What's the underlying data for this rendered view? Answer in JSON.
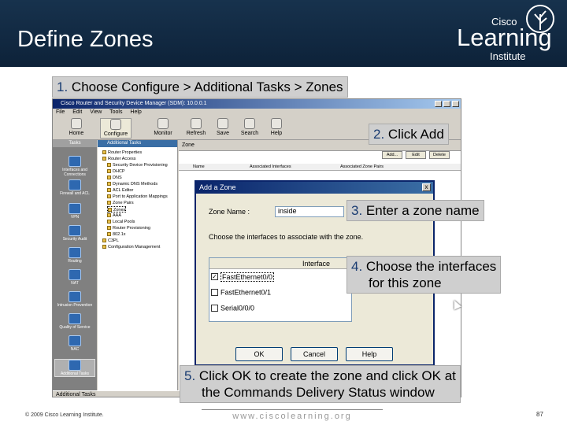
{
  "slide": {
    "title": "Define Zones",
    "logo": {
      "top": "Cisco",
      "main": "Learning",
      "bottom": "Institute"
    },
    "footer_copyright": "© 2009 Cisco Learning Institute.",
    "footer_url": "www.ciscolearning.org",
    "page_number": "87"
  },
  "callouts": [
    {
      "num": "1.",
      "text": " Choose Configure > Additional Tasks > Zones"
    },
    {
      "num": "2.",
      "text": " Click Add"
    },
    {
      "num": "3.",
      "text": " Enter a zone name"
    },
    {
      "num": "4.",
      "line1": " Choose the interfaces",
      "line2": "for this zone"
    },
    {
      "num": "5.",
      "line1": " Click OK to create the zone and click OK at",
      "line2": "the Commands Delivery Status window"
    }
  ],
  "app": {
    "window_title": "Cisco Router and Security Device Manager (SDM): 10.0.0.1",
    "menu": [
      "File",
      "Edit",
      "View",
      "Tools",
      "Help"
    ],
    "toolbar": [
      "Home",
      "Configure",
      "Monitor",
      "Refresh",
      "Save",
      "Search",
      "Help"
    ],
    "tasks_header": "Tasks",
    "left_tasks": [
      "Interfaces and Connections",
      "Firewall and ACL",
      "VPN",
      "Security Audit",
      "Routing",
      "NAT",
      "Intrusion Prevention",
      "Quality of Service",
      "NAC",
      "Additional Tasks"
    ],
    "tree_header": "Additional Tasks",
    "tree": [
      "Router Properties",
      "Router Access",
      "Security Device Provisioning",
      "DHCP",
      "DNS",
      "Dynamic DNS Methods",
      "ACL Editor",
      "Port to Application Mappings",
      "Zone Pairs",
      "Zones",
      "AAA",
      "Local Pools",
      "Router Provisioning",
      "802.1x",
      "C3PL",
      "Configuration Management"
    ],
    "zone_header": "Zone",
    "zone_buttons": [
      "Add...",
      "Edit",
      "Delete"
    ],
    "zone_columns": [
      "Name",
      "Associated Interfaces",
      "Associated Zone Pairs"
    ],
    "status_bar": "Additional Tasks"
  },
  "dialog": {
    "title": "Add a Zone",
    "close": "x",
    "zone_name_label": "Zone Name :",
    "zone_name_value": "inside",
    "instruction": "Choose the interfaces to associate with the zone.",
    "table_header": "Interface",
    "interfaces": [
      {
        "name": "FastEthernet0/0",
        "checked": true
      },
      {
        "name": "FastEthernet0/1",
        "checked": false
      },
      {
        "name": "Serial0/0/0",
        "checked": false
      }
    ],
    "buttons": {
      "ok": "OK",
      "cancel": "Cancel",
      "help": "Help"
    }
  },
  "colors": {
    "header_bg": "#17324d",
    "callout_bg": "#cfcfcf",
    "callout_num": "#1a3c72",
    "dialog_title": "#0a246a"
  }
}
